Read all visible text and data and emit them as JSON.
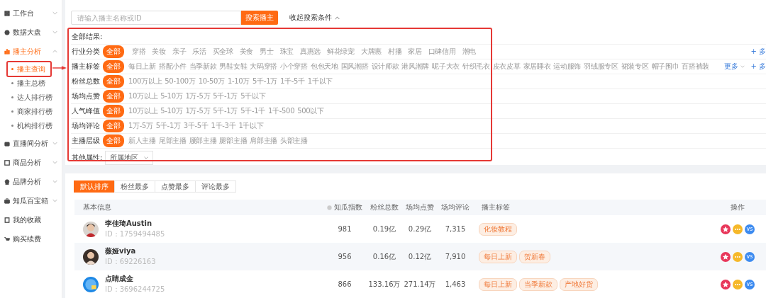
{
  "sidebar": {
    "items": [
      {
        "label": "工作台",
        "kind": "group",
        "expanded": false,
        "selected": false
      },
      {
        "label": "数据大盘",
        "kind": "group",
        "expanded": false,
        "selected": false
      },
      {
        "label": "播主分析",
        "kind": "group",
        "expanded": true,
        "selected": true,
        "children": [
          {
            "label": "播主查询",
            "selected": true
          },
          {
            "label": "播主总榜",
            "selected": false
          },
          {
            "label": "达人排行榜",
            "selected": false
          },
          {
            "label": "商家排行榜",
            "selected": false
          },
          {
            "label": "机构排行榜",
            "selected": false
          }
        ]
      },
      {
        "label": "直播间分析",
        "kind": "group",
        "expanded": false,
        "selected": false
      },
      {
        "label": "商品分析",
        "kind": "group",
        "expanded": false,
        "selected": false
      },
      {
        "label": "品牌分析",
        "kind": "group",
        "expanded": false,
        "selected": false
      },
      {
        "label": "知瓜百宝箱",
        "kind": "group",
        "expanded": false,
        "selected": false
      },
      {
        "label": "我的收藏",
        "kind": "link",
        "selected": false
      },
      {
        "label": "购买续费",
        "kind": "link",
        "selected": false
      }
    ]
  },
  "search": {
    "placeholder": "请输入播主名称或ID",
    "button": "搜索播主",
    "toggle": "收起搜索条件",
    "expanded": true
  },
  "filters": {
    "summary_label": "全部结果:",
    "rows": [
      {
        "label": "行业分类",
        "kind": "chips",
        "options": [
          {
            "label": "全部",
            "selected": true
          },
          {
            "label": "穿搭",
            "selected": false
          },
          {
            "label": "美妆",
            "selected": false
          },
          {
            "label": "亲子",
            "selected": false
          },
          {
            "label": "乐活",
            "selected": false
          },
          {
            "label": "买全球",
            "selected": false
          },
          {
            "label": "美食",
            "selected": false
          },
          {
            "label": "男士",
            "selected": false
          },
          {
            "label": "珠宝",
            "selected": false
          },
          {
            "label": "真惠选",
            "selected": false
          },
          {
            "label": "鲜花绿宠",
            "selected": false
          },
          {
            "label": "大牌惠",
            "selected": false
          },
          {
            "label": "村播",
            "selected": false
          },
          {
            "label": "家居",
            "selected": false
          },
          {
            "label": "口碑信用",
            "selected": false
          },
          {
            "label": "潮电",
            "selected": false
          }
        ],
        "multi": "+ 多"
      },
      {
        "label": "播主标签",
        "kind": "chips",
        "options": [
          {
            "label": "全部",
            "selected": true
          },
          {
            "label": "每日上新",
            "selected": false
          },
          {
            "label": "搭配小件",
            "selected": false
          },
          {
            "label": "当季新款",
            "selected": false
          },
          {
            "label": "男鞋女鞋",
            "selected": false
          },
          {
            "label": "大码穿搭",
            "selected": false
          },
          {
            "label": "小个穿搭",
            "selected": false
          },
          {
            "label": "包包天地",
            "selected": false
          },
          {
            "label": "国风潮搭",
            "selected": false
          },
          {
            "label": "设计师款",
            "selected": false
          },
          {
            "label": "港风潮牌",
            "selected": false
          },
          {
            "label": "呢子大衣",
            "selected": false
          },
          {
            "label": "针织毛衣",
            "selected": false
          },
          {
            "label": "皮衣皮草",
            "selected": false
          },
          {
            "label": "家居睡衣",
            "selected": false
          },
          {
            "label": "运动服饰",
            "selected": false
          },
          {
            "label": "羽绒服专区",
            "selected": false
          },
          {
            "label": "裙装专区",
            "selected": false
          },
          {
            "label": "帽子围巾",
            "selected": false
          },
          {
            "label": "百搭裤装",
            "selected": false
          }
        ],
        "more": "更多",
        "multi": "+ 多"
      },
      {
        "label": "粉丝总数",
        "kind": "chips",
        "options": [
          {
            "label": "全部",
            "selected": true
          },
          {
            "label": "100万以上",
            "selected": false
          },
          {
            "label": "50-100万",
            "selected": false
          },
          {
            "label": "10-50万",
            "selected": false
          },
          {
            "label": "1-10万",
            "selected": false
          },
          {
            "label": "5千-1万",
            "selected": false
          },
          {
            "label": "1千-5千",
            "selected": false
          },
          {
            "label": "1千以下",
            "selected": false
          }
        ]
      },
      {
        "label": "场均点赞",
        "kind": "chips",
        "options": [
          {
            "label": "全部",
            "selected": true
          },
          {
            "label": "10万以上",
            "selected": false
          },
          {
            "label": "5-10万",
            "selected": false
          },
          {
            "label": "1万-5万",
            "selected": false
          },
          {
            "label": "5千-1万",
            "selected": false
          },
          {
            "label": "5千以下",
            "selected": false
          }
        ]
      },
      {
        "label": "人气峰值",
        "kind": "chips",
        "options": [
          {
            "label": "全部",
            "selected": true
          },
          {
            "label": "10万以上",
            "selected": false
          },
          {
            "label": "5-10万",
            "selected": false
          },
          {
            "label": "1万-5万",
            "selected": false
          },
          {
            "label": "5千-1万",
            "selected": false
          },
          {
            "label": "5千-1千",
            "selected": false
          },
          {
            "label": "1千-500",
            "selected": false
          },
          {
            "label": "500以下",
            "selected": false
          }
        ]
      },
      {
        "label": "场均评论",
        "kind": "chips",
        "options": [
          {
            "label": "全部",
            "selected": true
          },
          {
            "label": "1万-5万",
            "selected": false
          },
          {
            "label": "5千-1万",
            "selected": false
          },
          {
            "label": "3千-5千",
            "selected": false
          },
          {
            "label": "1千-3千",
            "selected": false
          },
          {
            "label": "1千以下",
            "selected": false
          }
        ]
      },
      {
        "label": "主播层级",
        "kind": "chips",
        "options": [
          {
            "label": "全部",
            "selected": true
          },
          {
            "label": "新人主播",
            "selected": false
          },
          {
            "label": "尾部主播",
            "selected": false
          },
          {
            "label": "腰部主播",
            "selected": false
          },
          {
            "label": "腿部主播",
            "selected": false
          },
          {
            "label": "肩部主播",
            "selected": false
          },
          {
            "label": "头部主播",
            "selected": false
          }
        ]
      },
      {
        "label": "其他属性:",
        "kind": "dropdown",
        "value": "所属地区"
      }
    ]
  },
  "annotation": {
    "outline": true,
    "arrow": true,
    "menu_outline": true
  },
  "sort_tabs": [
    {
      "label": "默认排序",
      "selected": true
    },
    {
      "label": "粉丝最多",
      "selected": false
    },
    {
      "label": "点赞最多",
      "selected": false
    },
    {
      "label": "评论最多",
      "selected": false
    }
  ],
  "table": {
    "columns": [
      "基本信息",
      "知瓜指数",
      "粉丝总数",
      "场均点赞",
      "场均评论",
      "播主标签",
      "操作"
    ],
    "rows": [
      {
        "name": "李佳琦Austin",
        "id": "ID：1759494485",
        "index": "981",
        "fans": "0.19亿",
        "likes": "0.29亿",
        "comments": "7,315",
        "tags": [
          "化妆教程"
        ],
        "compare": "vs"
      },
      {
        "name": "薇娅viya",
        "id": "ID：69226163",
        "index": "956",
        "fans": "0.16亿",
        "likes": "0.12亿",
        "comments": "7,910",
        "tags": [
          "每日上新",
          "贺新春"
        ],
        "compare": "vs"
      },
      {
        "name": "点睛成金",
        "id": "ID：3696244725",
        "index": "866",
        "fans": "133.16万",
        "likes": "271.14万",
        "comments": "1,463",
        "tags": [
          "每日上新",
          "当季新款",
          "产地好货"
        ],
        "compare": "vs"
      }
    ]
  }
}
